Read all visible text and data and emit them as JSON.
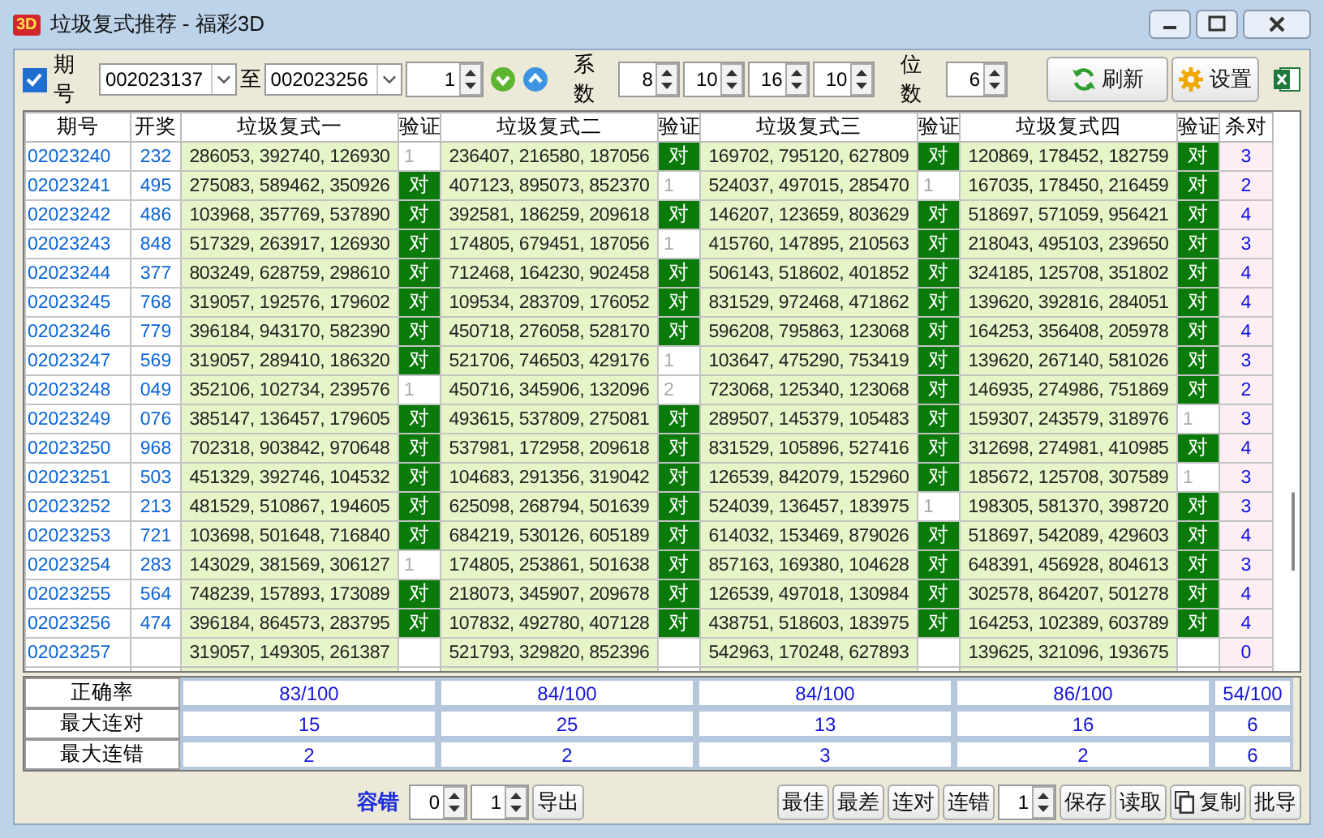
{
  "window": {
    "title": "垃圾复式推荐 - 福彩3D",
    "logo": "3D"
  },
  "toolbar": {
    "period_checkbox": {
      "label": "期号",
      "checked": true
    },
    "from_combo": "002023137",
    "to_label": "至",
    "to_combo": "002023256",
    "step_spin": "1",
    "coef_label": "系数",
    "coef_spins": [
      "8",
      "10",
      "16",
      "10"
    ],
    "digits_label": "位数",
    "digits_spin": "6",
    "refresh_button": "刷新",
    "settings_button": "设置"
  },
  "table": {
    "columns": [
      "期号",
      "开奖",
      "垃圾复式一",
      "验证",
      "垃圾复式二",
      "验证",
      "垃圾复式三",
      "验证",
      "垃圾复式四",
      "验证",
      "杀对"
    ],
    "rows": [
      {
        "period": "02023240",
        "draw": "232",
        "combos": [
          {
            "numbers": "286053, 392740, 126930",
            "verify": "1",
            "hit": false
          },
          {
            "numbers": "236407, 216580, 187056",
            "verify": "对",
            "hit": true
          },
          {
            "numbers": "169702, 795120, 627809",
            "verify": "对",
            "hit": true
          },
          {
            "numbers": "120869, 178452, 182759",
            "verify": "对",
            "hit": true
          }
        ],
        "kill": "3"
      },
      {
        "period": "02023241",
        "draw": "495",
        "combos": [
          {
            "numbers": "275083, 589462, 350926",
            "verify": "对",
            "hit": true
          },
          {
            "numbers": "407123, 895073, 852370",
            "verify": "1",
            "hit": false
          },
          {
            "numbers": "524037, 497015, 285470",
            "verify": "1",
            "hit": false
          },
          {
            "numbers": "167035, 178450, 216459",
            "verify": "对",
            "hit": true
          }
        ],
        "kill": "2"
      },
      {
        "period": "02023242",
        "draw": "486",
        "combos": [
          {
            "numbers": "103968, 357769, 537890",
            "verify": "对",
            "hit": true
          },
          {
            "numbers": "392581, 186259, 209618",
            "verify": "对",
            "hit": true
          },
          {
            "numbers": "146207, 123659, 803629",
            "verify": "对",
            "hit": true
          },
          {
            "numbers": "518697, 571059, 956421",
            "verify": "对",
            "hit": true
          }
        ],
        "kill": "4"
      },
      {
        "period": "02023243",
        "draw": "848",
        "combos": [
          {
            "numbers": "517329, 263917, 126930",
            "verify": "对",
            "hit": true
          },
          {
            "numbers": "174805, 679451, 187056",
            "verify": "1",
            "hit": false
          },
          {
            "numbers": "415760, 147895, 210563",
            "verify": "对",
            "hit": true
          },
          {
            "numbers": "218043, 495103, 239650",
            "verify": "对",
            "hit": true
          }
        ],
        "kill": "3"
      },
      {
        "period": "02023244",
        "draw": "377",
        "combos": [
          {
            "numbers": "803249, 628759, 298610",
            "verify": "对",
            "hit": true
          },
          {
            "numbers": "712468, 164230, 902458",
            "verify": "对",
            "hit": true
          },
          {
            "numbers": "506143, 518602, 401852",
            "verify": "对",
            "hit": true
          },
          {
            "numbers": "324185, 125708, 351802",
            "verify": "对",
            "hit": true
          }
        ],
        "kill": "4"
      },
      {
        "period": "02023245",
        "draw": "768",
        "combos": [
          {
            "numbers": "319057, 192576, 179602",
            "verify": "对",
            "hit": true
          },
          {
            "numbers": "109534, 283709, 176052",
            "verify": "对",
            "hit": true
          },
          {
            "numbers": "831529, 972468, 471862",
            "verify": "对",
            "hit": true
          },
          {
            "numbers": "139620, 392816, 284051",
            "verify": "对",
            "hit": true
          }
        ],
        "kill": "4"
      },
      {
        "period": "02023246",
        "draw": "779",
        "combos": [
          {
            "numbers": "396184, 943170, 582390",
            "verify": "对",
            "hit": true
          },
          {
            "numbers": "450718, 276058, 528170",
            "verify": "对",
            "hit": true
          },
          {
            "numbers": "596208, 795863, 123068",
            "verify": "对",
            "hit": true
          },
          {
            "numbers": "164253, 356408, 205978",
            "verify": "对",
            "hit": true
          }
        ],
        "kill": "4"
      },
      {
        "period": "02023247",
        "draw": "569",
        "combos": [
          {
            "numbers": "319057, 289410, 186320",
            "verify": "对",
            "hit": true
          },
          {
            "numbers": "521706, 746503, 429176",
            "verify": "1",
            "hit": false
          },
          {
            "numbers": "103647, 475290, 753419",
            "verify": "对",
            "hit": true
          },
          {
            "numbers": "139620, 267140, 581026",
            "verify": "对",
            "hit": true
          }
        ],
        "kill": "3"
      },
      {
        "period": "02023248",
        "draw": "049",
        "combos": [
          {
            "numbers": "352106, 102734, 239576",
            "verify": "1",
            "hit": false
          },
          {
            "numbers": "450716, 345906, 132096",
            "verify": "2",
            "hit": false
          },
          {
            "numbers": "723068, 125340, 123068",
            "verify": "对",
            "hit": true
          },
          {
            "numbers": "146935, 274986, 751869",
            "verify": "对",
            "hit": true
          }
        ],
        "kill": "2"
      },
      {
        "period": "02023249",
        "draw": "076",
        "combos": [
          {
            "numbers": "385147, 136457, 179605",
            "verify": "对",
            "hit": true
          },
          {
            "numbers": "493615, 537809, 275081",
            "verify": "对",
            "hit": true
          },
          {
            "numbers": "289507, 145379, 105483",
            "verify": "对",
            "hit": true
          },
          {
            "numbers": "159307, 243579, 318976",
            "verify": "1",
            "hit": false
          }
        ],
        "kill": "3"
      },
      {
        "period": "02023250",
        "draw": "968",
        "combos": [
          {
            "numbers": "702318, 903842, 970648",
            "verify": "对",
            "hit": true
          },
          {
            "numbers": "537981, 172958, 209618",
            "verify": "对",
            "hit": true
          },
          {
            "numbers": "831529, 105896, 527416",
            "verify": "对",
            "hit": true
          },
          {
            "numbers": "312698, 274981, 410985",
            "verify": "对",
            "hit": true
          }
        ],
        "kill": "4"
      },
      {
        "period": "02023251",
        "draw": "503",
        "combos": [
          {
            "numbers": "451329, 392746, 104532",
            "verify": "对",
            "hit": true
          },
          {
            "numbers": "104683, 291356, 319042",
            "verify": "对",
            "hit": true
          },
          {
            "numbers": "126539, 842079, 152960",
            "verify": "对",
            "hit": true
          },
          {
            "numbers": "185672, 125708, 307589",
            "verify": "1",
            "hit": false
          }
        ],
        "kill": "3"
      },
      {
        "period": "02023252",
        "draw": "213",
        "combos": [
          {
            "numbers": "481529, 510867, 194605",
            "verify": "对",
            "hit": true
          },
          {
            "numbers": "625098, 268794, 501639",
            "verify": "对",
            "hit": true
          },
          {
            "numbers": "524039, 136457, 183975",
            "verify": "1",
            "hit": false
          },
          {
            "numbers": "198305, 581370, 398720",
            "verify": "对",
            "hit": true
          }
        ],
        "kill": "3"
      },
      {
        "period": "02023253",
        "draw": "721",
        "combos": [
          {
            "numbers": "103698, 501648, 716840",
            "verify": "对",
            "hit": true
          },
          {
            "numbers": "684219, 530126, 605189",
            "verify": "对",
            "hit": true
          },
          {
            "numbers": "614032, 153469, 879026",
            "verify": "对",
            "hit": true
          },
          {
            "numbers": "518697, 542089, 429603",
            "verify": "对",
            "hit": true
          }
        ],
        "kill": "4"
      },
      {
        "period": "02023254",
        "draw": "283",
        "combos": [
          {
            "numbers": "143029, 381569, 306127",
            "verify": "1",
            "hit": false
          },
          {
            "numbers": "174805, 253861, 501638",
            "verify": "对",
            "hit": true
          },
          {
            "numbers": "857163, 169380, 104628",
            "verify": "对",
            "hit": true
          },
          {
            "numbers": "648391, 456928, 804613",
            "verify": "对",
            "hit": true
          }
        ],
        "kill": "3"
      },
      {
        "period": "02023255",
        "draw": "564",
        "combos": [
          {
            "numbers": "748239, 157893, 173089",
            "verify": "对",
            "hit": true
          },
          {
            "numbers": "218073, 345907, 209678",
            "verify": "对",
            "hit": true
          },
          {
            "numbers": "126539, 497018, 130984",
            "verify": "对",
            "hit": true
          },
          {
            "numbers": "302578, 864207, 501278",
            "verify": "对",
            "hit": true
          }
        ],
        "kill": "4"
      },
      {
        "period": "02023256",
        "draw": "474",
        "combos": [
          {
            "numbers": "396184, 864573, 283795",
            "verify": "对",
            "hit": true
          },
          {
            "numbers": "107832, 492780, 407128",
            "verify": "对",
            "hit": true
          },
          {
            "numbers": "438751, 518603, 183975",
            "verify": "对",
            "hit": true
          },
          {
            "numbers": "164253, 102389, 603789",
            "verify": "对",
            "hit": true
          }
        ],
        "kill": "4"
      },
      {
        "period": "02023257",
        "combos": [
          {
            "numbers": "319057, 149305, 261387"
          },
          {
            "numbers": "521793, 329820, 852396"
          },
          {
            "numbers": "542963, 170248, 627893"
          },
          {
            "numbers": "139625, 321096, 193675"
          }
        ],
        "kill": "0"
      }
    ]
  },
  "stats": [
    {
      "label": "正确率",
      "values": [
        "83/100",
        "84/100",
        "84/100",
        "86/100",
        "54/100"
      ]
    },
    {
      "label": "最大连对",
      "values": [
        "15",
        "25",
        "13",
        "16",
        "6"
      ]
    },
    {
      "label": "最大连错",
      "values": [
        "2",
        "2",
        "3",
        "2",
        "6"
      ]
    }
  ],
  "bottom": {
    "tolerance_label": "容错",
    "tolerance_spins": [
      "0",
      "1"
    ],
    "export_button": "导出",
    "mode_buttons": [
      "最佳",
      "最差",
      "连对",
      "连错"
    ],
    "count_spin": "1",
    "action_buttons": [
      {
        "label": "保存",
        "kind": "plain"
      },
      {
        "label": "读取",
        "kind": "plain"
      },
      {
        "label": "复制",
        "kind": "copy"
      },
      {
        "label": "批导",
        "kind": "plain"
      }
    ]
  }
}
